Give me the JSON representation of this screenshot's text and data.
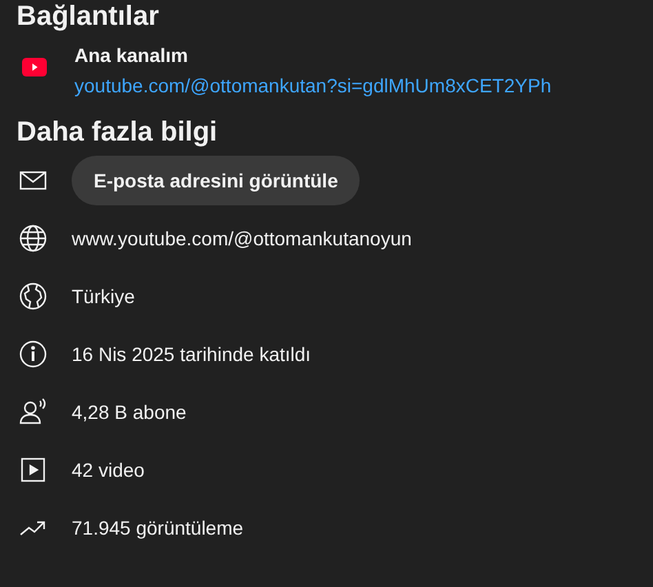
{
  "links_heading": "Bağlantılar",
  "links": [
    {
      "title": "Ana kanalım",
      "url": "youtube.com/@ottomankutan?si=gdlMhUm8xCET2YPh"
    }
  ],
  "info_heading": "Daha fazla bilgi",
  "info": [
    {
      "kind": "email",
      "text": "E-posta adresini görüntüle"
    },
    {
      "kind": "website",
      "text": "www.youtube.com/@ottomankutanoyun"
    },
    {
      "kind": "country",
      "text": "Türkiye"
    },
    {
      "kind": "joined",
      "text": "16 Nis 2025 tarihinde katıldı"
    },
    {
      "kind": "subscribers",
      "text": "4,28 B abone"
    },
    {
      "kind": "videos",
      "text": "42 video"
    },
    {
      "kind": "views",
      "text": "71.945 görüntüleme"
    }
  ]
}
